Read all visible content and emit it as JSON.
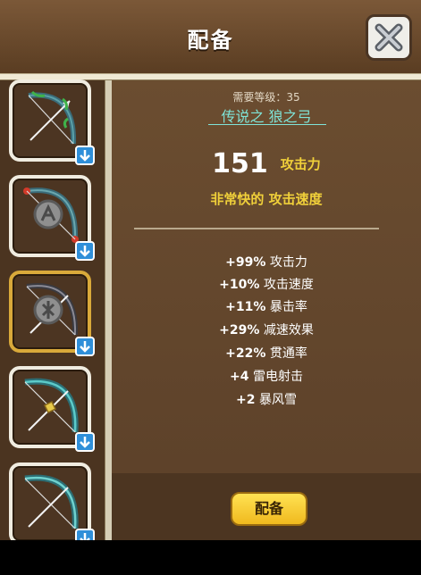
{
  "header": {
    "title": "配备"
  },
  "close_button": {
    "icon": "close-icon"
  },
  "slots": [
    {
      "icon": "bow-vine-icon",
      "badge_icon": "down-arrow-icon",
      "selected": false
    },
    {
      "icon": "bow-rune-red-icon",
      "badge_icon": "down-arrow-icon",
      "selected": false
    },
    {
      "icon": "bow-rune-icon",
      "badge_icon": "down-arrow-icon",
      "selected": true
    },
    {
      "icon": "bow-teal-gold-icon",
      "badge_icon": "down-arrow-icon",
      "selected": false
    },
    {
      "icon": "bow-teal-icon",
      "badge_icon": "down-arrow-icon",
      "selected": false
    }
  ],
  "item": {
    "requirement": "需要等级：35",
    "name": "传说之 狼之弓",
    "attack_value": "151",
    "attack_label": "攻击力",
    "speed_text": "非常快的 攻击速度",
    "stats": [
      {
        "value": "+99%",
        "label": "攻击力"
      },
      {
        "value": "+10%",
        "label": "攻击速度"
      },
      {
        "value": "+11%",
        "label": "暴击率"
      },
      {
        "value": "+29%",
        "label": "减速效果"
      },
      {
        "value": "+22%",
        "label": "贯通率"
      },
      {
        "value": "+4",
        "label": "雷电射击"
      },
      {
        "value": "+2",
        "label": "暴风雪"
      }
    ]
  },
  "equip_button": {
    "label": "配备"
  },
  "colors": {
    "name_teal": "#7fe4d8",
    "gold_text": "#f0d03a",
    "slot_selected": "#d9a93a",
    "equip_button": "#f5c531"
  }
}
